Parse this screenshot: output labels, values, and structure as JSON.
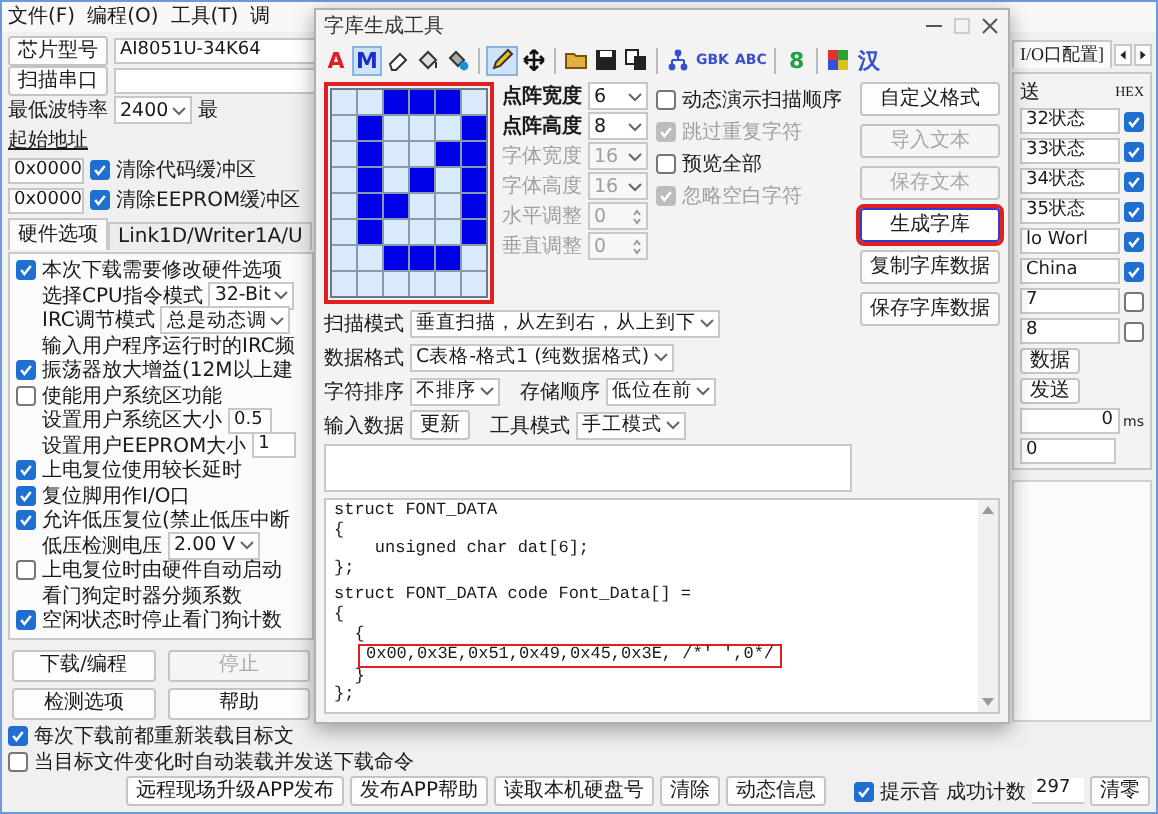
{
  "menu": [
    {
      "label": "文件(F)"
    },
    {
      "label": "编程(O)"
    },
    {
      "label": "工具(T)"
    },
    {
      "label": "调"
    }
  ],
  "left_panel": {
    "chip_button": "芯片型号",
    "chip_value": "AI8051U-34K64",
    "scan_button": "扫描串口",
    "baud_label": "最低波特率",
    "baud_value": "2400",
    "baud_next_label": "最",
    "start_label": "起始地址",
    "addresses": [
      {
        "value": "0x0000",
        "label": "清除代码缓冲区",
        "checked": true
      },
      {
        "value": "0x0000",
        "label": "清除EEPROM缓冲区",
        "checked": true
      }
    ],
    "tabs": [
      {
        "label": "硬件选项",
        "selected": true
      },
      {
        "label": "Link1D/Writer1A/U",
        "selected": false
      }
    ],
    "options": [
      {
        "kind": "check",
        "label": "本次下载需要修改硬件选项",
        "checked": true
      },
      {
        "kind": "select",
        "label": "选择CPU指令模式",
        "value": "32-Bit"
      },
      {
        "kind": "select",
        "label": "IRC调节模式",
        "value": "总是动态调"
      },
      {
        "kind": "text",
        "label": "输入用户程序运行时的IRC频"
      },
      {
        "kind": "check",
        "label": "振荡器放大增益(12M以上建",
        "checked": true
      },
      {
        "kind": "check",
        "label": "使能用户系统区功能",
        "checked": false
      },
      {
        "kind": "field",
        "label": "设置用户系统区大小",
        "value": "0.5"
      },
      {
        "kind": "field",
        "label": "设置用户EEPROM大小",
        "value": "1"
      },
      {
        "kind": "check",
        "label": "上电复位使用较长延时",
        "checked": true
      },
      {
        "kind": "check",
        "label": "复位脚用作I/O口",
        "checked": true
      },
      {
        "kind": "check",
        "label": "允许低压复位(禁止低压中断",
        "checked": true
      },
      {
        "kind": "select",
        "label": "低压检测电压",
        "value": "2.00 V"
      },
      {
        "kind": "check",
        "label": "上电复位时由硬件自动启动",
        "checked": false
      },
      {
        "kind": "text",
        "label": "看门狗定时器分频系数"
      },
      {
        "kind": "check",
        "label": "空闲状态时停止看门狗计数",
        "checked": true
      }
    ],
    "buttons": [
      {
        "label": "下载/编程",
        "disabled": false
      },
      {
        "label": "停止",
        "disabled": true
      },
      {
        "label": "检测选项",
        "disabled": false
      },
      {
        "label": "帮助",
        "disabled": false
      }
    ]
  },
  "bottom_checks": [
    {
      "label": "每次下载前都重新装载目标文",
      "checked": true
    },
    {
      "label": "当目标文件变化时自动装载并发送下载命令",
      "checked": false
    }
  ],
  "status_bar": {
    "buttons": [
      "远程现场升级APP发布",
      "发布APP帮助",
      "读取本机硬盘号",
      "清除",
      "动态信息"
    ],
    "beep": {
      "label": "提示音",
      "checked": true
    },
    "count_label": "成功计数",
    "count": "297",
    "reset_button": "清零"
  },
  "right_panel": {
    "tab": "I/O口配置]",
    "group_label": "送",
    "hex_label": "HEX",
    "rows": [
      {
        "value": "32状态",
        "checked": true
      },
      {
        "value": "33状态",
        "checked": true
      },
      {
        "value": "34状态",
        "checked": true
      },
      {
        "value": "35状态",
        "checked": true
      },
      {
        "value": "lo Worl",
        "checked": true
      },
      {
        "value": "China",
        "checked": true
      },
      {
        "value": "7",
        "checked": false
      },
      {
        "value": "8",
        "checked": false
      }
    ],
    "buttons": [
      "数据",
      "发送"
    ],
    "delay": "0",
    "unit": "ms",
    "count": "0"
  },
  "dialog": {
    "title": "字库生成工具",
    "tools": [
      {
        "kind": "letter",
        "text": "A",
        "color": "#e02020",
        "selected": false
      },
      {
        "kind": "letter",
        "text": "M",
        "color": "#1a2fd0",
        "selected": true
      },
      {
        "kind": "eraser",
        "selected": false
      },
      {
        "kind": "bucket",
        "selected": false
      },
      {
        "kind": "fill",
        "selected": false
      },
      {
        "kind": "separator"
      },
      {
        "kind": "pencil",
        "selected": true
      },
      {
        "kind": "move",
        "selected": false
      },
      {
        "kind": "separator"
      },
      {
        "kind": "folder",
        "selected": false
      },
      {
        "kind": "save",
        "selected": false
      },
      {
        "kind": "copy",
        "selected": false
      },
      {
        "kind": "separator"
      },
      {
        "kind": "tree",
        "selected": false
      },
      {
        "kind": "letter",
        "text": "GBK",
        "color": "#3a4fd0",
        "selected": false
      },
      {
        "kind": "letter",
        "text": "ABC",
        "color": "#3a4fd0",
        "selected": false
      },
      {
        "kind": "separator"
      },
      {
        "kind": "letter",
        "text": "8",
        "color": "#20a040",
        "selected": false
      },
      {
        "kind": "separator"
      },
      {
        "kind": "palette",
        "selected": false
      },
      {
        "kind": "letter",
        "text": "汉",
        "color": "#3a4fd0",
        "selected": false
      }
    ],
    "pixel_grid": {
      "highlighted": true,
      "rows": [
        [
          false,
          false,
          true,
          true,
          true,
          false
        ],
        [
          false,
          true,
          false,
          false,
          false,
          true
        ],
        [
          false,
          true,
          false,
          false,
          true,
          true
        ],
        [
          false,
          true,
          false,
          true,
          false,
          true
        ],
        [
          false,
          true,
          true,
          false,
          false,
          true
        ],
        [
          false,
          true,
          false,
          false,
          false,
          true
        ],
        [
          false,
          false,
          true,
          true,
          true,
          false
        ],
        [
          false,
          false,
          false,
          false,
          false,
          false
        ]
      ]
    },
    "settings": [
      {
        "kind": "select",
        "label": "点阵宽度",
        "value": "6",
        "disabled": false
      },
      {
        "kind": "select",
        "label": "点阵高度",
        "value": "8",
        "disabled": false
      },
      {
        "kind": "select",
        "label": "字体宽度",
        "value": "16",
        "disabled": true
      },
      {
        "kind": "select",
        "label": "字体高度",
        "value": "16",
        "disabled": true
      },
      {
        "kind": "spin",
        "label": "水平调整",
        "value": "0",
        "disabled": true
      },
      {
        "kind": "spin",
        "label": "垂直调整",
        "value": "0",
        "disabled": true
      }
    ],
    "checks": [
      {
        "label": "动态演示扫描顺序",
        "checked": false,
        "disabled": false
      },
      {
        "label": "跳过重复字符",
        "checked": true,
        "disabled": true
      },
      {
        "label": "预览全部",
        "checked": false,
        "disabled": false
      },
      {
        "label": "忽略空白字符",
        "checked": true,
        "disabled": true
      }
    ],
    "scan_label": "扫描模式",
    "scan_value": "垂直扫描，从左到右，从上到下",
    "format_label": "数据格式",
    "format_value": "C表格-格式1 (纯数据格式)",
    "sort_label": "字符排序",
    "sort_value": "不排序",
    "order_label": "存储顺序",
    "order_value": "低位在前",
    "input_label": "输入数据",
    "update_button": "更新",
    "mode_label": "工具模式",
    "mode_value": "手工模式",
    "buttons": [
      {
        "label": "自定义格式",
        "disabled": false,
        "highlighted": false
      },
      {
        "label": "导入文本",
        "disabled": true,
        "highlighted": false
      },
      {
        "label": "保存文本",
        "disabled": true,
        "highlighted": false
      },
      {
        "label": "生成字库",
        "disabled": false,
        "highlighted": true
      },
      {
        "label": "复制字库数据",
        "disabled": false,
        "highlighted": false
      },
      {
        "label": "保存字库数据",
        "disabled": false,
        "highlighted": false
      }
    ],
    "code_blocks": [
      [
        {
          "text": "struct FONT_DATA",
          "highlighted": false
        },
        {
          "text": "{",
          "highlighted": false
        },
        {
          "text": "    unsigned char dat[6];",
          "highlighted": false
        },
        {
          "text": "};",
          "highlighted": false
        }
      ],
      [
        {
          "text": "struct FONT_DATA code Font_Data[] =",
          "highlighted": false
        },
        {
          "text": "{",
          "highlighted": false
        },
        {
          "text": "  {",
          "highlighted": false
        },
        {
          "text": "0x00,0x3E,0x51,0x49,0x45,0x3E, /*' ',0*/",
          "highlighted": true
        },
        {
          "text": "  }",
          "highlighted": false
        },
        {
          "text": "};",
          "highlighted": false
        }
      ]
    ]
  }
}
